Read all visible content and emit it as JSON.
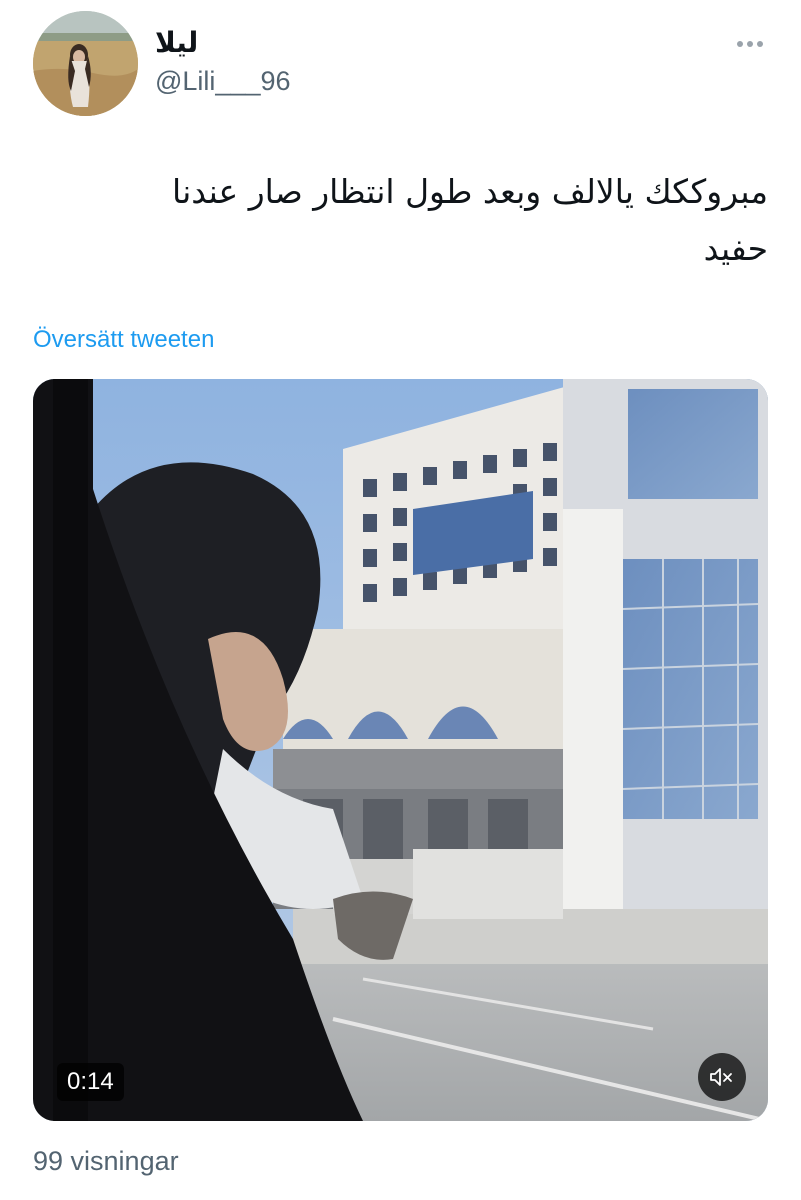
{
  "tweet": {
    "author": {
      "display_name": "ليلا",
      "handle": "@Lili___96"
    },
    "text_lines": [
      "مبروككك يالالف وبعد طول انتظار صار عندنا",
      "حفيد"
    ],
    "translate_label": "Översätt tweeten",
    "media": {
      "type": "video",
      "duration": "0:14",
      "muted": true
    },
    "views_label": "99 visningar"
  },
  "icons": {
    "more": "more-horizontal-icon",
    "mute": "volume-muted-icon"
  },
  "colors": {
    "link": "#1d9bf0",
    "secondary_text": "#536471",
    "primary_text": "#0f1419"
  }
}
